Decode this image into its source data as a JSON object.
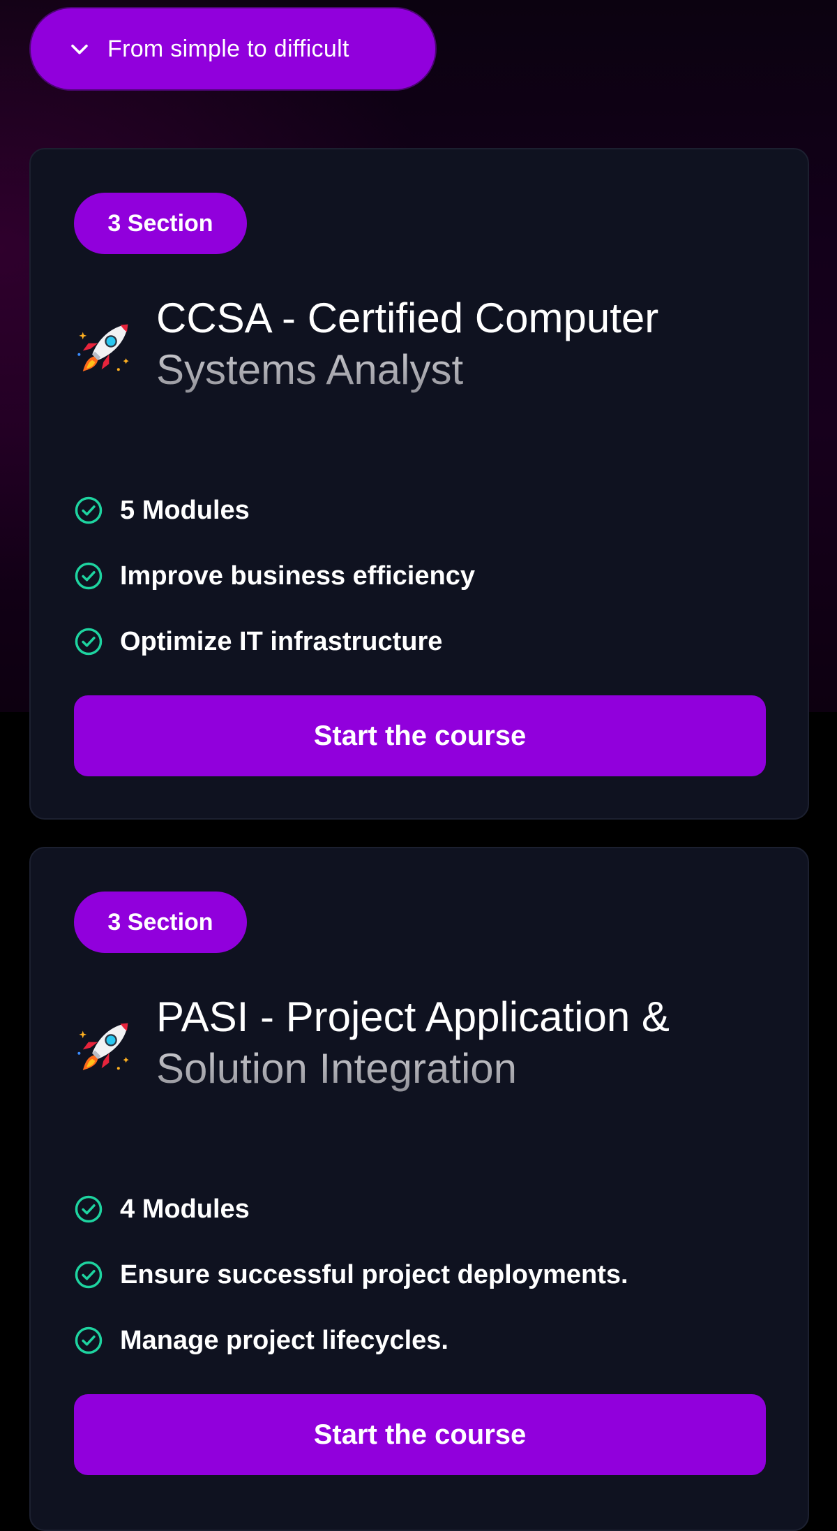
{
  "sort": {
    "label": "From simple to difficult",
    "icon": "chevron-down-icon"
  },
  "colors": {
    "accent": "#9100dc",
    "card_bg": "#0f1220",
    "check": "#1ed4a0"
  },
  "courses": [
    {
      "badge": "3 Section",
      "icon": "rocket-icon",
      "title_line1": "CCSA - Certified Computer",
      "title_line2": "Systems Analyst",
      "features": [
        "5 Modules",
        "Improve business efficiency",
        "Optimize IT infrastructure"
      ],
      "button_label": "Start the course"
    },
    {
      "badge": "3 Section",
      "icon": "rocket-icon",
      "title_line1": "PASI - Project Application &",
      "title_line2": "Solution Integration",
      "features": [
        "4 Modules",
        "Ensure successful project deployments.",
        "Manage project lifecycles."
      ],
      "button_label": "Start the course"
    }
  ]
}
